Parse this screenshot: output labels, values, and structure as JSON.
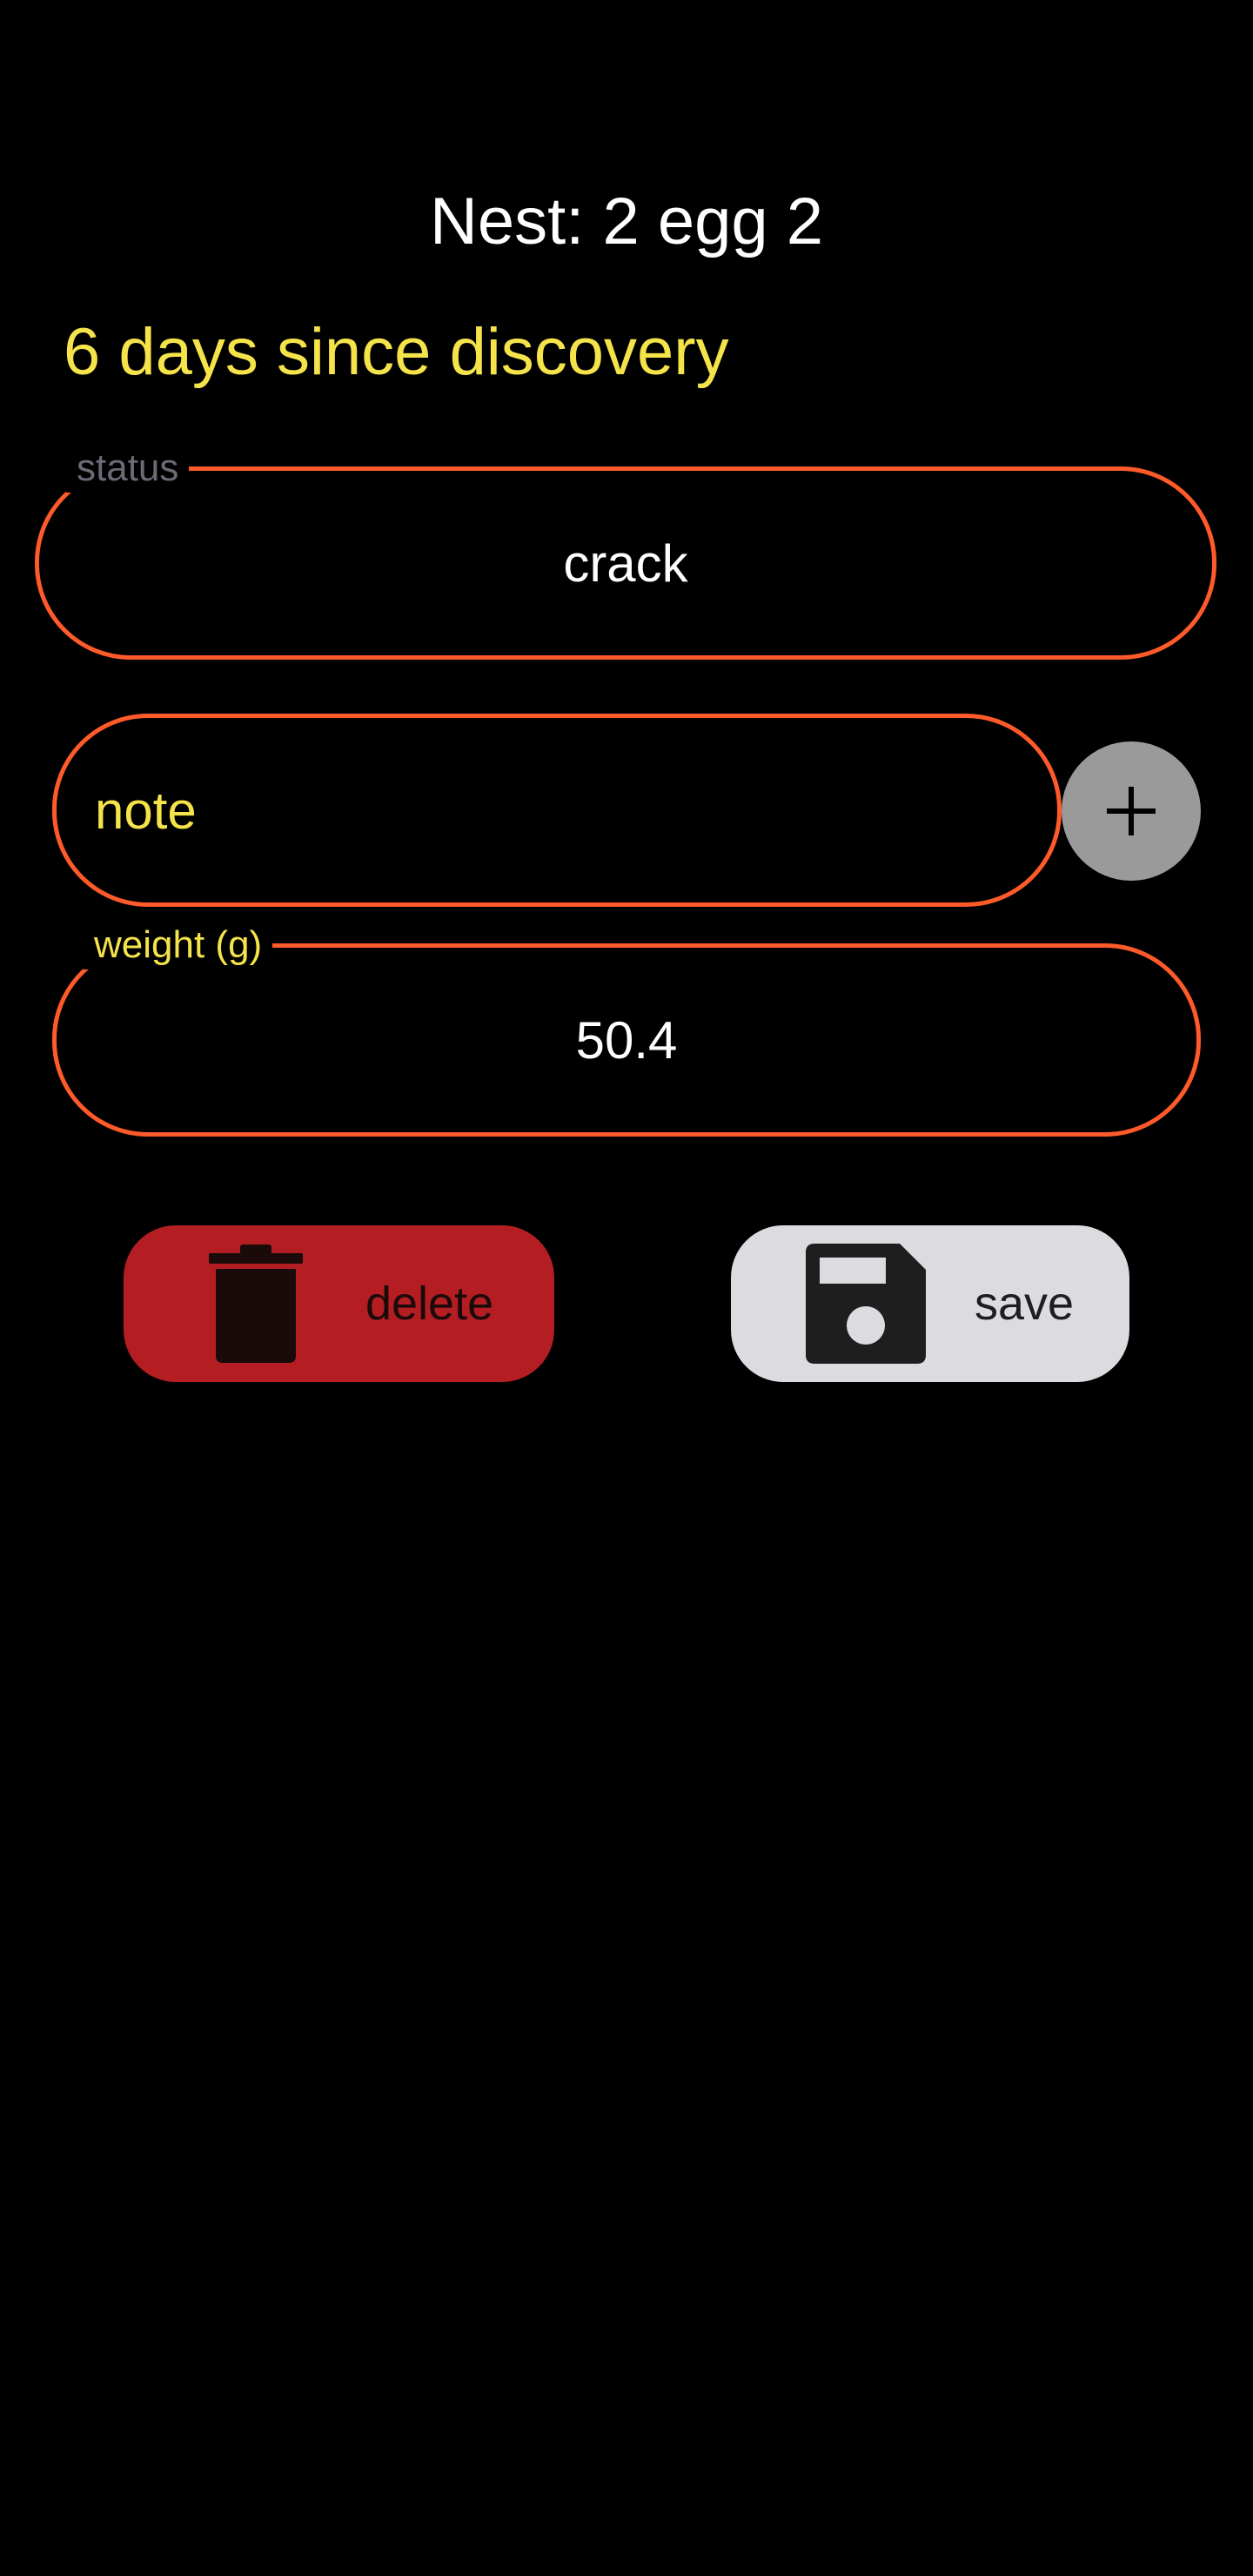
{
  "header": {
    "title": "Nest: 2 egg 2",
    "subtitle": "6 days since discovery"
  },
  "status_field": {
    "label": "status",
    "value": "crack"
  },
  "note_field": {
    "placeholder": "note",
    "value": ""
  },
  "add_button": {
    "icon": "plus-icon"
  },
  "weight_field": {
    "label": "weight (g)",
    "value": "50.4"
  },
  "actions": {
    "delete_label": "delete",
    "delete_icon": "trash-icon",
    "save_label": "save",
    "save_icon": "floppy-disk-icon"
  },
  "colors": {
    "background": "#000000",
    "accent_border": "#ff5a2a",
    "highlight_text": "#f5e34a",
    "delete_bg": "#b41e23",
    "save_bg": "#dcdbe0",
    "add_bg": "#9a9a9a"
  }
}
